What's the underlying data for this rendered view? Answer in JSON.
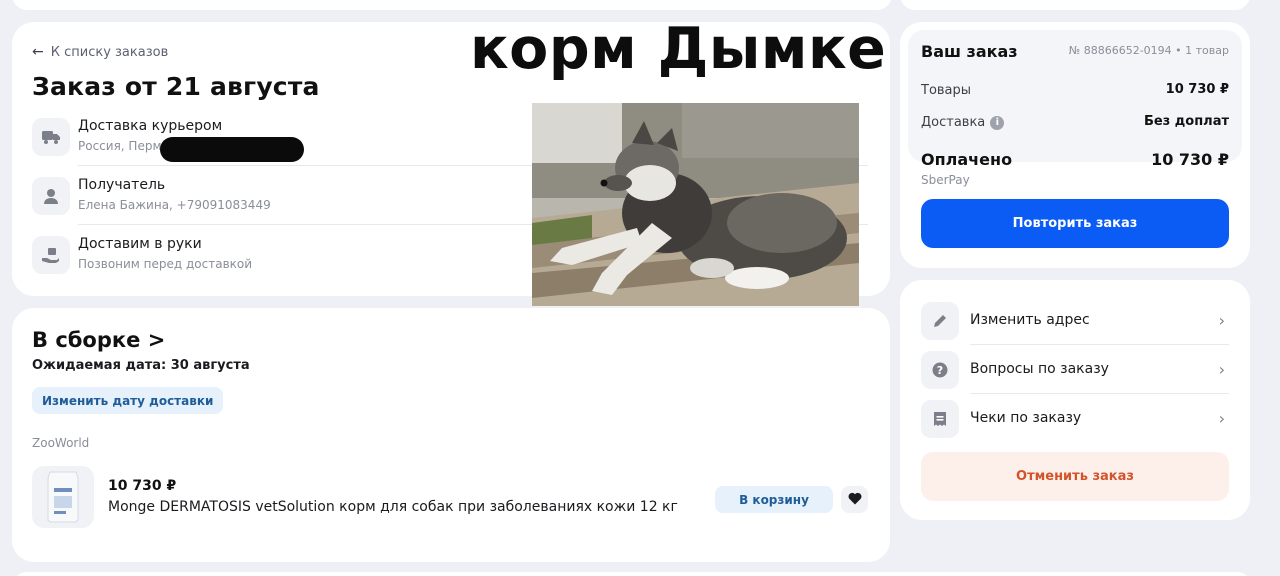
{
  "order": {
    "back_link": "К списку заказов",
    "title": "Заказ от 21 августа",
    "delivery": {
      "title": "Доставка курьером",
      "sub": "Россия, Пермь"
    },
    "recipient": {
      "title": "Получатель",
      "sub": "Елена Бажина, +79091083449"
    },
    "handover": {
      "title": "Доставим в руки",
      "sub": "Позвоним перед доставкой"
    }
  },
  "overlay_caption": "корм Дымке",
  "assembly": {
    "title": "В сборке",
    "title_chevron": ">",
    "expected_date": "Ожидаемая дата: 30 августа",
    "change_date_label": "Изменить дату доставки",
    "seller": "ZooWorld",
    "product": {
      "price": "10 730 ₽",
      "name": "Monge DERMATOSIS vetSolution корм для собак при заболеваниях кожи 12 кг",
      "to_cart_label": "В корзину"
    }
  },
  "summary": {
    "title": "Ваш заказ",
    "order_number": "№ 88866652-0194 • 1 товар",
    "goods_label": "Товары",
    "goods_value": "10 730 ₽",
    "delivery_label": "Доставка",
    "delivery_value": "Без доплат",
    "paid_label": "Оплачено",
    "paid_value": "10 730 ₽",
    "pay_method": "SberPay",
    "repeat_label": "Повторить заказ"
  },
  "actions": {
    "items": [
      {
        "label": "Изменить адрес",
        "icon": "pencil-icon"
      },
      {
        "label": "Вопросы по заказу",
        "icon": "question-icon"
      },
      {
        "label": "Чеки по заказу",
        "icon": "receipt-icon"
      }
    ],
    "cancel_label": "Отменить заказ"
  },
  "colors": {
    "accent_blue": "#0b5cf5",
    "soft_blue": "#e6f1fc",
    "cancel_bg": "#fdf0ea",
    "cancel_text": "#d2542b",
    "page_bg": "#eef0f5"
  }
}
